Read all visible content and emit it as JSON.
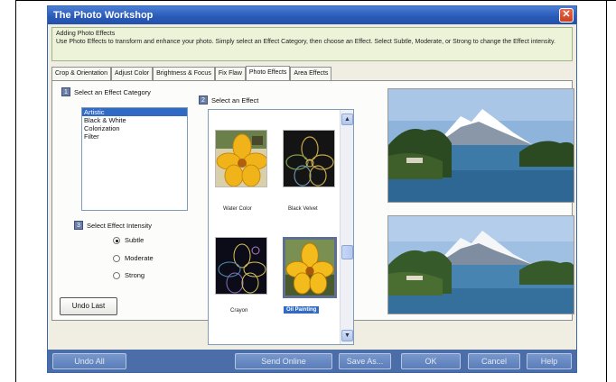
{
  "window": {
    "title": "The Photo Workshop",
    "close_glyph": "✕"
  },
  "help": {
    "heading": "Adding Photo Effects",
    "body": "Use Photo Effects to transform and enhance your photo.  Simply select an Effect Category, then choose an Effect.  Select Subtle, Moderate, or Strong to change the Effect intensity."
  },
  "tabs": [
    {
      "label": "Crop & Orientation"
    },
    {
      "label": "Adjust Color"
    },
    {
      "label": "Brightness & Focus"
    },
    {
      "label": "Fix Flaw"
    },
    {
      "label": "Photo Effects",
      "active": true
    },
    {
      "label": "Area Effects"
    }
  ],
  "step1": {
    "num": "1",
    "label": "Select an Effect Category"
  },
  "step2": {
    "num": "2",
    "label": "Select an Effect"
  },
  "step3": {
    "num": "3",
    "label": "Select Effect Intensity"
  },
  "categories": {
    "items": [
      "Artistic",
      "Black & White",
      "Colorization",
      "Filter"
    ],
    "selected": "Artistic"
  },
  "intensity": {
    "options": [
      "Subtle",
      "Moderate",
      "Strong"
    ],
    "selected": "Subtle"
  },
  "effects": [
    {
      "label": "Water Color"
    },
    {
      "label": "Black Velvet"
    },
    {
      "label": "Crayon"
    },
    {
      "label": "Oil Painting",
      "selected": true
    }
  ],
  "undo_last_label": "Undo Last",
  "bottom_buttons": {
    "undo_all": "Undo All",
    "send_online": "Send Online",
    "save_as": "Save As...",
    "ok": "OK",
    "cancel": "Cancel",
    "help": "Help"
  },
  "colors": {
    "title_bar": "#2a5bb8",
    "bottom_bar": "#4c6ea8",
    "selection": "#316ac5",
    "help_bg": "#ecf3d8"
  }
}
